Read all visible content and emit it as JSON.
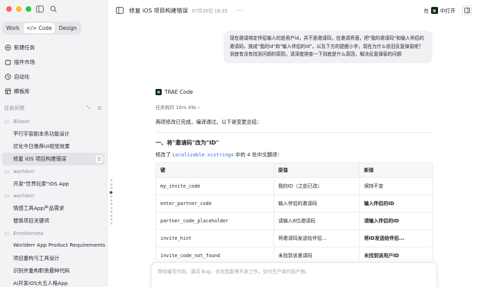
{
  "sidebar": {
    "modes": [
      "Work",
      "Code",
      "Design"
    ],
    "active_mode": "Code",
    "nav": [
      {
        "label": "新建任务",
        "icon": "plus-circle-icon"
      },
      {
        "label": "插件市场",
        "icon": "plugin-icon"
      },
      {
        "label": "自动化",
        "icon": "automation-icon"
      },
      {
        "label": "模板库",
        "icon": "template-icon"
      }
    ],
    "tasks_header": "任务列表",
    "groups": [
      {
        "name": "Blisser",
        "tasks": [
          "平行宇宙剧本杀功能设计",
          "优化今日推荐UI视觉效果",
          "修复 iOS 项目构建错误"
        ]
      },
      {
        "name": "worlderr",
        "tasks": [
          "开发\"世界玩家\"iOS App"
        ]
      },
      {
        "name": "worlderr",
        "tasks": [
          "情感工具App产品需求",
          "替换项目关键词"
        ]
      },
      {
        "name": "Emotionsea",
        "tasks": [
          "Worlderr App Product Requirements",
          "项目重构与工具设计",
          "识别并重构职责最种代码",
          "AI开发iOS大五人格App"
        ]
      }
    ],
    "active_task": "修复 iOS 项目构建错误"
  },
  "header": {
    "title": "修复 iOS 项目构建错误",
    "date": "07月20日 19:35",
    "more": "···",
    "open_prefix": "在",
    "open_label": "中打开"
  },
  "chat": {
    "user_message": "现在邀请绑定伴侣输入的是用户id，并不是邀请码，在邀请界面，把\"我的邀请码\"和输入伴侣的邀请码，换成\"我的id\"和\"输入伴侣的id\"，以及下方的提醒小字，现在为什么依旧反复弹窗呢？到底有没有找到问题的原因，请深度排查一下到底是什么原因，解决反复弹窗的问题",
    "agent_name": "TRAE Code",
    "elapsed": "任务耗时 16m 49s ›",
    "summary": "两项修改已完成，编译通过。以下是变更总结：",
    "section_title": "一、将\"邀请码\"改为\"ID\"",
    "modified_prefix": "修改了",
    "modified_file": "Localizable.xcstrings",
    "modified_suffix": "中的 4 处中文翻译：",
    "table": {
      "headers": [
        "键",
        "原值",
        "新值"
      ],
      "rows": [
        [
          "my_invite_code",
          "我的ID（之前已改）",
          "保持不变"
        ],
        [
          "enter_partner_code",
          "输入伴侣的邀请码",
          "输入伴侣的ID"
        ],
        [
          "partner_code_placeholder",
          "请输入8位邀请码",
          "请输入伴侣的ID"
        ],
        [
          "invite_hint",
          "将邀请码发送给伴侣...",
          "将ID发送给伴侣..."
        ],
        [
          "invite_code_not_found",
          "未找到该邀请码",
          "未找到该用户ID"
        ]
      ]
    }
  },
  "composer": {
    "placeholder": "帮你编写代码、调试 Bug、优化性能等开发工作，交付生产级代码产物。"
  }
}
